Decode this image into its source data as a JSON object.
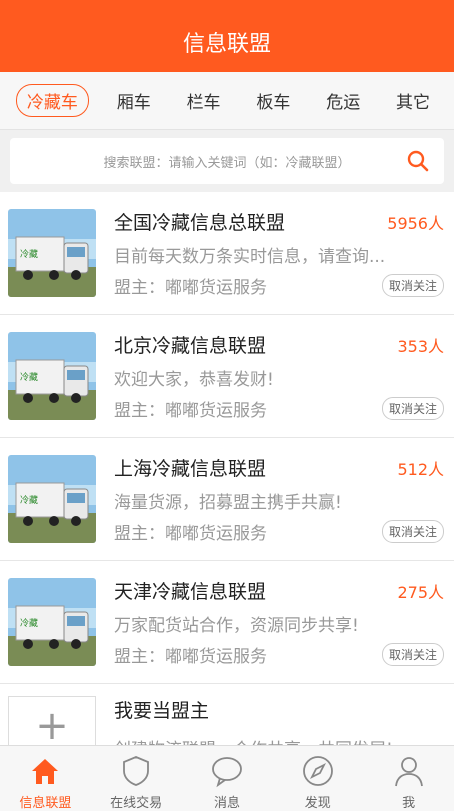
{
  "header": {
    "title": "信息联盟"
  },
  "tabs": [
    {
      "label": "冷藏车",
      "active": true
    },
    {
      "label": "厢车"
    },
    {
      "label": "栏车"
    },
    {
      "label": "板车"
    },
    {
      "label": "危运"
    },
    {
      "label": "其它"
    }
  ],
  "search": {
    "placeholder": "搜索联盟：请输入关键词（如：冷藏联盟）"
  },
  "items": [
    {
      "title": "全国冷藏信息总联盟",
      "count": "5956人",
      "desc": "目前每天数万条实时信息，请查询...",
      "owner": "盟主：嘟嘟货运服务",
      "action": "取消关注"
    },
    {
      "title": "北京冷藏信息联盟",
      "count": "353人",
      "desc": "欢迎大家，恭喜发财!",
      "owner": "盟主：嘟嘟货运服务",
      "action": "取消关注"
    },
    {
      "title": "上海冷藏信息联盟",
      "count": "512人",
      "desc": "海量货源，招募盟主携手共赢!",
      "owner": "盟主：嘟嘟货运服务",
      "action": "取消关注"
    },
    {
      "title": "天津冷藏信息联盟",
      "count": "275人",
      "desc": "万家配货站合作，资源同步共享!",
      "owner": "盟主：嘟嘟货运服务",
      "action": "取消关注"
    }
  ],
  "add": {
    "plus": "+",
    "title": "我要当盟主",
    "desc": "创建物流联盟，合作共享，共同发展!"
  },
  "bottom_nav": [
    {
      "label": "信息联盟",
      "icon": "home-icon",
      "active": true
    },
    {
      "label": "在线交易",
      "icon": "shield-icon"
    },
    {
      "label": "消息",
      "icon": "chat-icon"
    },
    {
      "label": "发现",
      "icon": "compass-icon"
    },
    {
      "label": "我",
      "icon": "user-icon"
    }
  ],
  "colors": {
    "accent": "#ff5a1f"
  }
}
